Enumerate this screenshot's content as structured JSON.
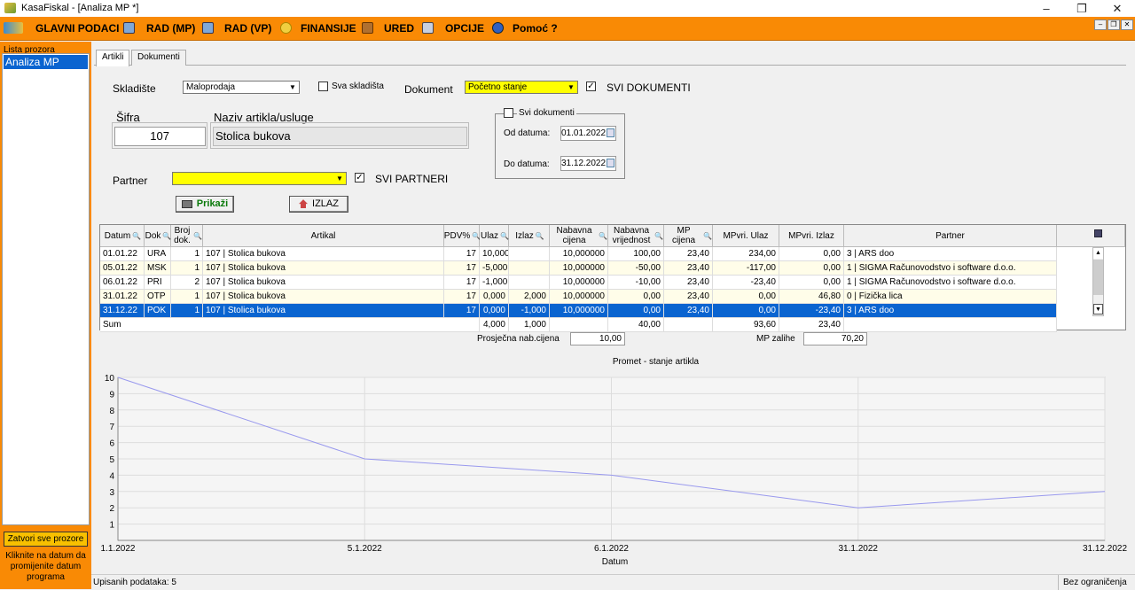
{
  "window": {
    "app": "KasaFiskal",
    "title": "KasaFiskal  - [Analiza MP *]"
  },
  "menu": [
    {
      "label": "GLAVNI PODACI",
      "icon": "doc-icon"
    },
    {
      "label": "RAD (MP)",
      "icon": "doc-icon"
    },
    {
      "label": "RAD (VP)",
      "icon": "coin-icon"
    },
    {
      "label": "FINANSIJE",
      "icon": "box-icon"
    },
    {
      "label": "URED",
      "icon": "tools-icon"
    },
    {
      "label": "OPCIJE",
      "icon": "help-icon"
    },
    {
      "label": "Pomoć ?",
      "icon": ""
    }
  ],
  "left": {
    "header": "Lista prozora",
    "items": [
      "Analiza MP"
    ],
    "close_all": "Zatvori sve prozore",
    "hint": "Kliknite na datum da promijenite datum programa"
  },
  "tabs": [
    "Artikli",
    "Dokumenti"
  ],
  "filters": {
    "skladiste_label": "Skladište",
    "skladiste_value": "Maloprodaja",
    "sva_skladista": "Sva skladišta",
    "dokument_label": "Dokument",
    "dokument_value": "Početno stanje",
    "svi_dokumenti_main": "SVI DOKUMENTI",
    "sifra_label": "Šifra",
    "sifra_value": "107",
    "naziv_label": "Naziv artikla/usluge",
    "naziv_value": "Stolica bukova",
    "svi_dokumenti": "Svi dokumenti",
    "od_label": "Od datuma:",
    "od_value": "01.01.2022",
    "do_label": "Do datuma:",
    "do_value": "31.12.2022",
    "partner_label": "Partner",
    "partner_value": "",
    "svi_partneri": "SVI PARTNERI"
  },
  "buttons": {
    "prikazi": "Prikaži",
    "izlaz": "IZLAZ"
  },
  "grid": {
    "headers": [
      "Datum",
      "Dok",
      "Broj dok.",
      "Artikal",
      "PDV%",
      "Ulaz",
      "Izlaz",
      "Nabavna cijena",
      "Nabavna vrijednost",
      "MP cijena",
      "MPvri. Ulaz",
      "MPvri. Izlaz",
      "Partner"
    ],
    "rows": [
      [
        "01.01.22",
        "URA",
        "1",
        "107 | Stolica bukova",
        "17",
        "10,000",
        "",
        "10,000000",
        "100,00",
        "23,40",
        "234,00",
        "0,00",
        "3 | ARS doo"
      ],
      [
        "05.01.22",
        "MSK",
        "1",
        "107 | Stolica bukova",
        "17",
        "-5,000",
        "",
        "10,000000",
        "-50,00",
        "23,40",
        "-117,00",
        "0,00",
        "1 | SIGMA Računovodstvo i software d.o.o."
      ],
      [
        "06.01.22",
        "PRI",
        "2",
        "107 | Stolica bukova",
        "17",
        "-1,000",
        "",
        "10,000000",
        "-10,00",
        "23,40",
        "-23,40",
        "0,00",
        "1 | SIGMA Računovodstvo i software d.o.o."
      ],
      [
        "31.01.22",
        "OTP",
        "1",
        "107 | Stolica bukova",
        "17",
        "0,000",
        "2,000",
        "10,000000",
        "0,00",
        "23,40",
        "0,00",
        "46,80",
        "0 | Fizička lica"
      ],
      [
        "31.12.22",
        "POK",
        "1",
        "107 | Stolica bukova",
        "17",
        "0,000",
        "-1,000",
        "10,000000",
        "0,00",
        "23,40",
        "0,00",
        "-23,40",
        "3 | ARS doo"
      ]
    ],
    "sum": {
      "label": "Sum",
      "ulaz": "4,000",
      "izlaz": "1,000",
      "nab_vrij": "40,00",
      "mp_ulaz": "93,60",
      "mp_izlaz": "23,40"
    }
  },
  "totals": {
    "prosjecna_label": "Prosječna nab.cijena",
    "prosjecna_value": "10,00",
    "mp_zalihe_label": "MP zalihe",
    "mp_zalihe_value": "70,20"
  },
  "chart_data": {
    "type": "line",
    "title": "Promet - stanje artikla",
    "xlabel": "Datum",
    "ylabel": "",
    "x": [
      "1.1.2022",
      "5.1.2022",
      "6.1.2022",
      "31.1.2022",
      "31.12.2022"
    ],
    "series": [
      {
        "values": [
          10,
          5,
          4,
          2,
          3
        ]
      }
    ],
    "ylim": [
      0,
      10
    ],
    "yticks": [
      1,
      2,
      3,
      4,
      5,
      6,
      7,
      8,
      9,
      10
    ],
    "grid": true,
    "line_color": "#9999ee"
  },
  "status": {
    "left": "Upisanih podataka: 5",
    "right": "Bez ograničenja"
  }
}
